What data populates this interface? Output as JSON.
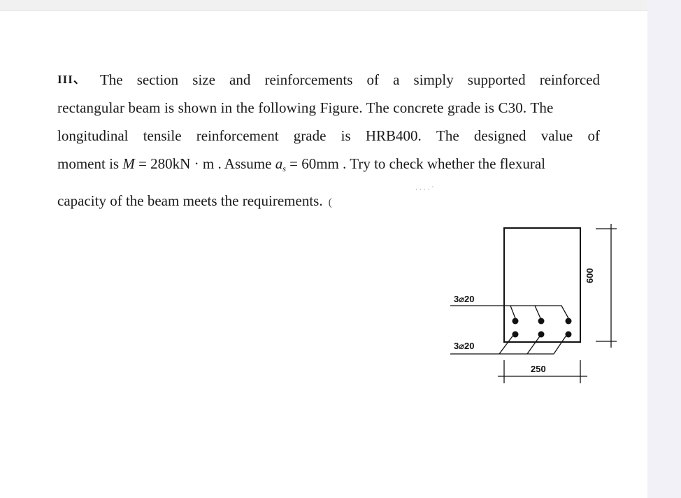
{
  "problem": {
    "number": "III、",
    "line1_words": [
      "The",
      "section",
      "size",
      "and",
      "reinforcements",
      "of",
      "a",
      "simply",
      "supported",
      "reinforced"
    ],
    "line2": "rectangular beam is shown in the following Figure. The concrete grade is C30. The",
    "line3_words": [
      "longitudinal",
      "tensile",
      "reinforcement",
      "grade",
      "is",
      "HRB400.",
      "The",
      "designed",
      "value",
      "of"
    ],
    "line4": {
      "pre": "moment is ",
      "moment_symbol": "M",
      "moment_value": " = 280kN · m",
      "mid": " . Assume ",
      "as_symbol": "a",
      "as_sub": "s",
      "as_value": " = 60mm",
      "post": " . Try to check whether the flexural"
    },
    "line5": "capacity of the beam meets the requirements.",
    "trailing_paren": "(",
    "faint_mark": "·  ·  ·  ·  `"
  },
  "figure": {
    "top_rebar_label": "3⌀20",
    "bottom_rebar_label": "3⌀20",
    "width_dimension": "250",
    "height_dimension": "600",
    "section": {
      "width_mm": 250,
      "height_mm": 600
    },
    "bars_per_row": 3,
    "rows": 2
  }
}
